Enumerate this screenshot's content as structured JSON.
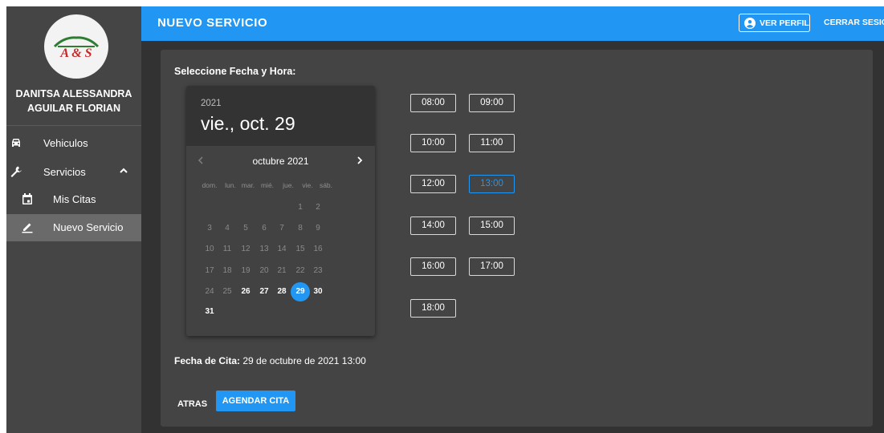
{
  "colors": {
    "accent": "#2196f3",
    "sidebar_bg": "#454545",
    "panel_bg": "#444444",
    "frame_bg": "#323232"
  },
  "sidebar": {
    "logo_text": "A & S",
    "user_name_line1": "DANITSA ALESSANDRA",
    "user_name_line2": "AGUILAR FLORIAN",
    "items": [
      {
        "label": "Vehiculos",
        "icon": "car-icon"
      },
      {
        "label": "Servicios",
        "icon": "wrench-icon"
      },
      {
        "label": "Mis Citas",
        "icon": "calendar-icon"
      },
      {
        "label": "Nuevo Servicio",
        "icon": "pencil-icon"
      }
    ]
  },
  "header": {
    "title": "NUEVO SERVICIO",
    "profile_label": "VER PERFIL",
    "logout_label": "CERRAR SESIÓN"
  },
  "main": {
    "section_title": "Seleccione Fecha y Hora:",
    "picker": {
      "year": "2021",
      "date": "vie., oct. 29",
      "month": "octubre 2021",
      "weekdays": [
        "dom.",
        "lun.",
        "mar.",
        "mié.",
        "jue.",
        "vie.",
        "sáb."
      ],
      "days": [
        "1",
        "2",
        "3",
        "4",
        "5",
        "6",
        "7",
        "8",
        "9",
        "10",
        "11",
        "12",
        "13",
        "14",
        "15",
        "16",
        "17",
        "18",
        "19",
        "20",
        "21",
        "22",
        "23",
        "24",
        "25",
        "26",
        "27",
        "28",
        "29",
        "30",
        "31"
      ],
      "enabled_days": [
        "26",
        "27",
        "28",
        "29",
        "30",
        "31"
      ],
      "selected_day": "29"
    },
    "times": [
      "08:00",
      "09:00",
      "10:00",
      "11:00",
      "12:00",
      "13:00",
      "14:00",
      "15:00",
      "16:00",
      "17:00",
      "18:00"
    ],
    "selected_time": "13:00",
    "fecha_label": "Fecha de Cita:",
    "fecha_value": " 29 de octubre de 2021 13:00",
    "back_label": "ATRAS",
    "submit_label": "AGENDAR CITA"
  }
}
